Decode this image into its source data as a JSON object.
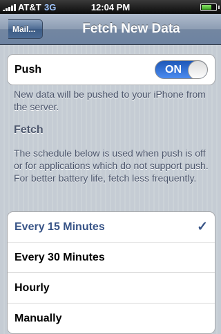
{
  "status_bar": {
    "carrier": "AT&T",
    "network": "3G",
    "time": "12:04 PM",
    "battery_level": 0.8
  },
  "nav": {
    "back_label": "Mail...",
    "title": "Fetch New Data"
  },
  "push": {
    "label": "Push",
    "toggle_state": "ON",
    "description": "New data will be pushed to your iPhone from the server."
  },
  "fetch": {
    "header": "Fetch",
    "description": "The schedule below is used when push is off or for applications which do not support push. For better battery life, fetch less frequently.",
    "options": [
      {
        "label": "Every 15 Minutes",
        "selected": true
      },
      {
        "label": "Every 30 Minutes",
        "selected": false
      },
      {
        "label": "Hourly",
        "selected": false
      },
      {
        "label": "Manually",
        "selected": false
      }
    ],
    "check_glyph": "✓"
  },
  "colors": {
    "selected_text": "#385487",
    "toggle_on": "#2f6ed6"
  }
}
